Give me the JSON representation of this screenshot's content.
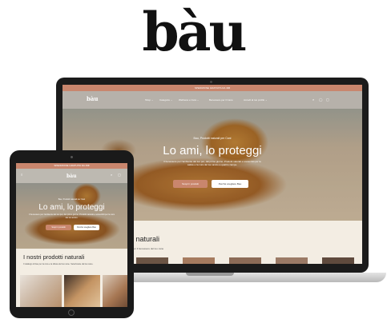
{
  "brand": {
    "logo_text": "bàu"
  },
  "laptop_site": {
    "announcement": "SPEDIZIONE GRATUITA DA 49€",
    "brand": "bàu",
    "nav": [
      {
        "label": "Shop ⌄"
      },
      {
        "label": "Categorie ⌄"
      },
      {
        "label": "Wellness e Cura ⌄"
      },
      {
        "label": "Benessere per il Cane"
      },
      {
        "label": "Accedi al tuo profilo ⌄"
      }
    ],
    "icons": [
      "search-icon",
      "account-icon",
      "cart-icon"
    ],
    "hero": {
      "tagline": "Bau, Prodotti naturali per Cani",
      "title": "Lo ami, lo proteggi",
      "subtitle": "Il benessere per l'ambiente del tuo pet, dal primo giorno. Prodotti naturali e sostenibili per la salute e la cura del tuo amico a quattro zampe.",
      "primary_button": "Scopri i prodotti",
      "secondary_button": "Perché scegliere Bau"
    },
    "section": {
      "title": "tti naturali",
      "subtitle": "ese per il benessere del tuo cane"
    }
  },
  "tablet_site": {
    "announcement": "SPEDIZIONE GRATUITA DA 49€",
    "brand": "bàu",
    "hero": {
      "tagline": "Bau, Prodotti naturali per Cani",
      "title": "Lo ami, lo proteggi",
      "subtitle": "Il benessere per l'ambiente del tuo pet, dal primo giorno. Prodotti naturali e sostenibili per la cura del tuo amico.",
      "primary_button": "Scopri i prodotti",
      "secondary_button": "Perché scegliere Bau"
    },
    "section": {
      "title": "I nostri prodotti naturali",
      "subtitle": "Il catalogo di bau per la cura e la difesa del tuo cane. Selezionate dal tuo cane."
    }
  },
  "colors": {
    "accent": "#c9866d",
    "cream": "#f3ede3",
    "device_frame": "#1b1b1b"
  }
}
